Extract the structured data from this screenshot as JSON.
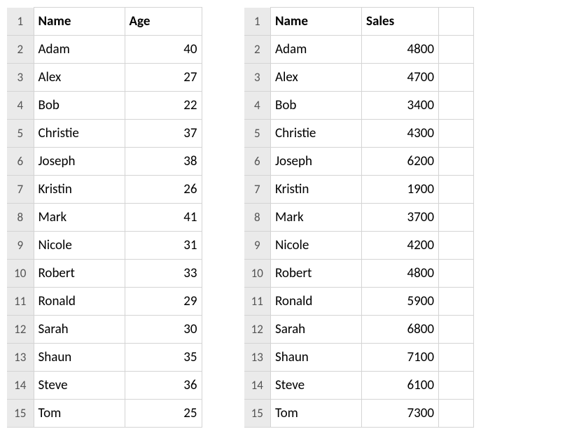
{
  "left": {
    "headers": {
      "nameLabel": "Name",
      "valueLabel": "Age"
    },
    "rowNums": [
      "1",
      "2",
      "3",
      "4",
      "5",
      "6",
      "7",
      "8",
      "9",
      "10",
      "11",
      "12",
      "13",
      "14",
      "15"
    ],
    "rows": [
      {
        "name": "Adam",
        "value": "40"
      },
      {
        "name": "Alex",
        "value": "27"
      },
      {
        "name": "Bob",
        "value": "22"
      },
      {
        "name": "Christie",
        "value": "37"
      },
      {
        "name": "Joseph",
        "value": "38"
      },
      {
        "name": "Kristin",
        "value": "26"
      },
      {
        "name": "Mark",
        "value": "41"
      },
      {
        "name": "Nicole",
        "value": "31"
      },
      {
        "name": "Robert",
        "value": "33"
      },
      {
        "name": "Ronald",
        "value": "29"
      },
      {
        "name": "Sarah",
        "value": "30"
      },
      {
        "name": "Shaun",
        "value": "35"
      },
      {
        "name": "Steve",
        "value": "36"
      },
      {
        "name": "Tom",
        "value": "25"
      }
    ]
  },
  "right": {
    "headers": {
      "nameLabel": "Name",
      "valueLabel": "Sales"
    },
    "rowNums": [
      "1",
      "2",
      "3",
      "4",
      "5",
      "6",
      "7",
      "8",
      "9",
      "10",
      "11",
      "12",
      "13",
      "14",
      "15"
    ],
    "rows": [
      {
        "name": "Adam",
        "value": "4800"
      },
      {
        "name": "Alex",
        "value": "4700"
      },
      {
        "name": "Bob",
        "value": "3400"
      },
      {
        "name": "Christie",
        "value": "4300"
      },
      {
        "name": "Joseph",
        "value": "6200"
      },
      {
        "name": "Kristin",
        "value": "1900"
      },
      {
        "name": "Mark",
        "value": "3700"
      },
      {
        "name": "Nicole",
        "value": "4200"
      },
      {
        "name": "Robert",
        "value": "4800"
      },
      {
        "name": "Ronald",
        "value": "5900"
      },
      {
        "name": "Sarah",
        "value": "6800"
      },
      {
        "name": "Shaun",
        "value": "7100"
      },
      {
        "name": "Steve",
        "value": "6100"
      },
      {
        "name": "Tom",
        "value": "7300"
      }
    ]
  }
}
